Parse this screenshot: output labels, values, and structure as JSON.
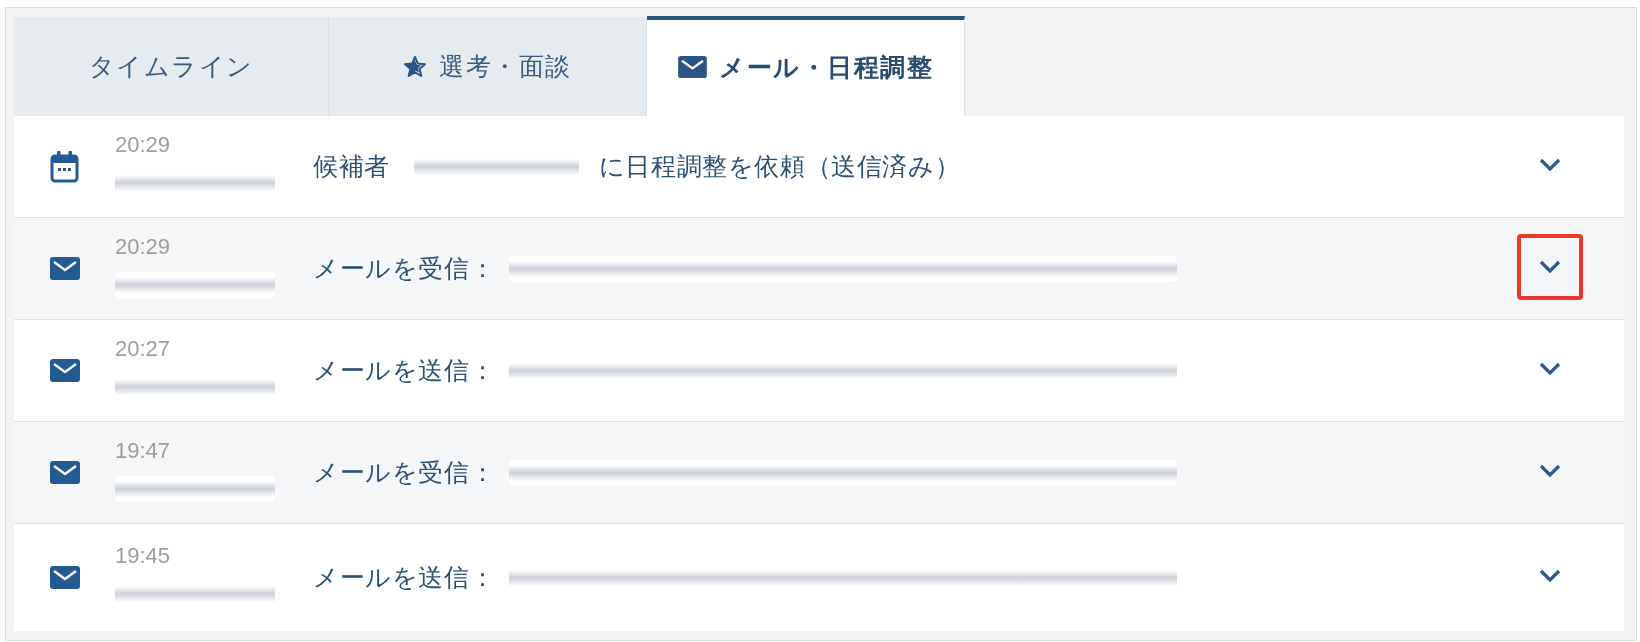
{
  "tabs": [
    {
      "label": "タイムライン",
      "selected": false
    },
    {
      "label": "選考・面談",
      "selected": false
    },
    {
      "label": "メール・日程調整",
      "selected": true
    }
  ],
  "events": [
    {
      "kind": "calendar",
      "time": "20:29",
      "text_before": "候補者",
      "text_after": "に日程調整を依頼（送信済み）",
      "expanded": false,
      "highlighted": false
    },
    {
      "kind": "mail",
      "time": "20:29",
      "text_before": "メールを受信：",
      "expanded": false,
      "highlighted": true
    },
    {
      "kind": "mail",
      "time": "20:27",
      "text_before": "メールを送信：",
      "expanded": false,
      "highlighted": false
    },
    {
      "kind": "mail",
      "time": "19:47",
      "text_before": "メールを受信：",
      "expanded": false,
      "highlighted": false
    },
    {
      "kind": "mail",
      "time": "19:45",
      "text_before": "メールを送信：",
      "expanded": false,
      "highlighted": false
    }
  ]
}
